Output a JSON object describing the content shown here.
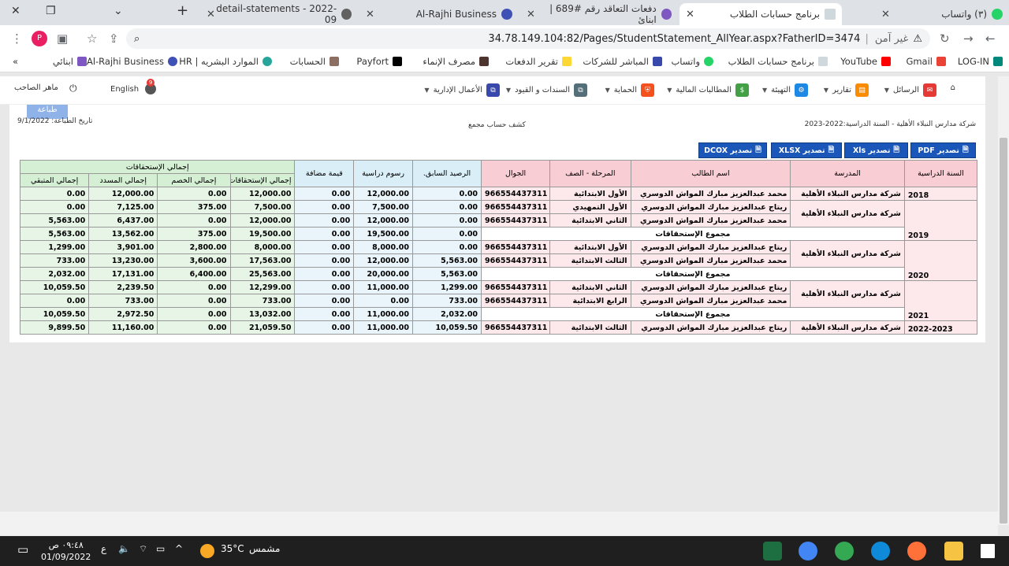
{
  "browser": {
    "tabs": [
      {
        "label": "(٣) واتساب",
        "active": false
      },
      {
        "label": "برنامج حسابات الطلاب",
        "active": true
      },
      {
        "label": "دفعات التعاقد رقم #689 | ابنائ",
        "active": false
      },
      {
        "label": "Al-Rajhi Business",
        "active": false
      },
      {
        "label": "detail-statements - 2022-09",
        "active": false
      }
    ],
    "new_tab": "+",
    "address": {
      "security_label": "غير آمن",
      "url": "34.78.149.104:82/Pages/StudentStatement_AllYear.aspx?FatherID=3474"
    },
    "profile_initial": "P",
    "bookmarks": [
      "LOG-IN",
      "Gmail",
      "YouTube",
      "برنامج حسابات الطلاب",
      "واتساب",
      "المباشر للشركات",
      "تقرير الدفعات",
      "مصرف الإنماء",
      "Payfort",
      "الحسابات",
      "الموارد البشريه | HR",
      "Al-Rajhi Business",
      "ابنائي"
    ],
    "bookmarks_more": "»"
  },
  "app_nav": {
    "items": [
      {
        "label": "الرسائل",
        "color": "#e53935"
      },
      {
        "label": "تقارير",
        "color": "#fb8c00"
      },
      {
        "label": "التهيئة",
        "color": "#1e88e5"
      },
      {
        "label": "المطالبات المالية",
        "color": "#43a047"
      },
      {
        "label": "الحماية",
        "color": "#f4511e"
      },
      {
        "label": "السندات و القيود",
        "color": "#546e7a"
      },
      {
        "label": "الأعمال الإدارية",
        "color": "#3949ab"
      }
    ],
    "language": "English",
    "notifications_count": "9",
    "user": "ماهر الصاحب"
  },
  "report": {
    "school_year_line": "شركة مدارس النبلاء الأهلية - السنة الدراسية:2022-2023",
    "title": "كشف حساب مجمع",
    "print_date": "تاريخ الطباعة: 9/1/2022",
    "print_button": "طباعة",
    "exports": [
      "تصدير PDF",
      "تصدير Xls",
      "تصدير XLSX",
      "تصدير DCOX"
    ]
  },
  "table": {
    "headers": {
      "year": "السنة الدراسية",
      "school": "المدرسة",
      "student": "اسم الطالب",
      "grade": "المرحلة - الصف",
      "mobile": "الجوال",
      "prev_balance": "الرصيد السابق.",
      "fees": "رسوم دراسية",
      "vat": "قيمة مضافة",
      "totals_group": "إجمالي الإستحقاقات",
      "total_due": "إجمالي الإستحقاقات",
      "total_discount": "إجمالي الخصم",
      "total_paid": "إجمالي المسدد",
      "total_remaining": "إجمالي المتبقي"
    },
    "subtotal_label": "مجموع الإستحقاقات",
    "groups": [
      {
        "year": "2018",
        "school": "شركة مدارس النبلاء الأهلية",
        "rows": [
          {
            "student": "محمد عبدالعزيز مبارك المواش الدوسري",
            "grade": "الأول الابتدائية",
            "mobile": "966554437311",
            "prev": "0.00",
            "fees": "12,000.00",
            "vat": "0.00",
            "due": "12,000.00",
            "disc": "0.00",
            "paid": "12,000.00",
            "rem": "0.00"
          }
        ],
        "subtotal": null
      },
      {
        "year": "2019",
        "school": "شركة مدارس النبلاء الأهلية",
        "rows": [
          {
            "student": "ريتاج عبدالعزيز مبارك المواش الدوسري",
            "grade": "الأول التمهيدي",
            "mobile": "966554437311",
            "prev": "0.00",
            "fees": "7,500.00",
            "vat": "0.00",
            "due": "7,500.00",
            "disc": "375.00",
            "paid": "7,125.00",
            "rem": "0.00"
          },
          {
            "student": "محمد عبدالعزيز مبارك المواش الدوسري",
            "grade": "الثاني الابتدائية",
            "mobile": "966554437311",
            "prev": "0.00",
            "fees": "12,000.00",
            "vat": "0.00",
            "due": "12,000.00",
            "disc": "0.00",
            "paid": "6,437.00",
            "rem": "5,563.00"
          }
        ],
        "subtotal": {
          "prev": "0.00",
          "fees": "19,500.00",
          "vat": "0.00",
          "due": "19,500.00",
          "disc": "375.00",
          "paid": "13,562.00",
          "rem": "5,563.00"
        }
      },
      {
        "year": "2020",
        "school": "شركة مدارس النبلاء الأهلية",
        "rows": [
          {
            "student": "ريتاج عبدالعزيز مبارك المواش الدوسري",
            "grade": "الأول الابتدائية",
            "mobile": "966554437311",
            "prev": "0.00",
            "fees": "8,000.00",
            "vat": "0.00",
            "due": "8,000.00",
            "disc": "2,800.00",
            "paid": "3,901.00",
            "rem": "1,299.00"
          },
          {
            "student": "محمد عبدالعزيز مبارك المواش الدوسري",
            "grade": "الثالث الابتدائية",
            "mobile": "966554437311",
            "prev": "5,563.00",
            "fees": "12,000.00",
            "vat": "0.00",
            "due": "17,563.00",
            "disc": "3,600.00",
            "paid": "13,230.00",
            "rem": "733.00"
          }
        ],
        "subtotal": {
          "prev": "5,563.00",
          "fees": "20,000.00",
          "vat": "0.00",
          "due": "25,563.00",
          "disc": "6,400.00",
          "paid": "17,131.00",
          "rem": "2,032.00"
        }
      },
      {
        "year": "2021",
        "school": "شركة مدارس النبلاء الأهلية",
        "rows": [
          {
            "student": "ريتاج عبدالعزيز مبارك المواش الدوسري",
            "grade": "الثاني الابتدائية",
            "mobile": "966554437311",
            "prev": "1,299.00",
            "fees": "11,000.00",
            "vat": "0.00",
            "due": "12,299.00",
            "disc": "0.00",
            "paid": "2,239.50",
            "rem": "10,059.50"
          },
          {
            "student": "محمد عبدالعزيز مبارك المواش الدوسري",
            "grade": "الرابع الابتدائية",
            "mobile": "966554437311",
            "prev": "733.00",
            "fees": "0.00",
            "vat": "0.00",
            "due": "733.00",
            "disc": "0.00",
            "paid": "733.00",
            "rem": "0.00"
          }
        ],
        "subtotal": {
          "prev": "2,032.00",
          "fees": "11,000.00",
          "vat": "0.00",
          "due": "13,032.00",
          "disc": "0.00",
          "paid": "2,972.50",
          "rem": "10,059.50"
        }
      },
      {
        "year": "2022-2023",
        "school": "شركة مدارس النبلاء الأهلية",
        "rows": [
          {
            "student": "ريتاج عبدالعزيز مبارك المواش الدوسري",
            "grade": "الثالث الابتدائية",
            "mobile": "966554437311",
            "prev": "10,059.50",
            "fees": "11,000.00",
            "vat": "0.00",
            "due": "21,059.50",
            "disc": "0.00",
            "paid": "11,160.00",
            "rem": "9,899.50"
          }
        ],
        "subtotal": null
      }
    ]
  },
  "taskbar": {
    "time": "٠٩:٤٨ ص",
    "date": "01/09/2022",
    "lang": "ع",
    "weather_temp": "35°C",
    "weather_label": "مشمس"
  }
}
